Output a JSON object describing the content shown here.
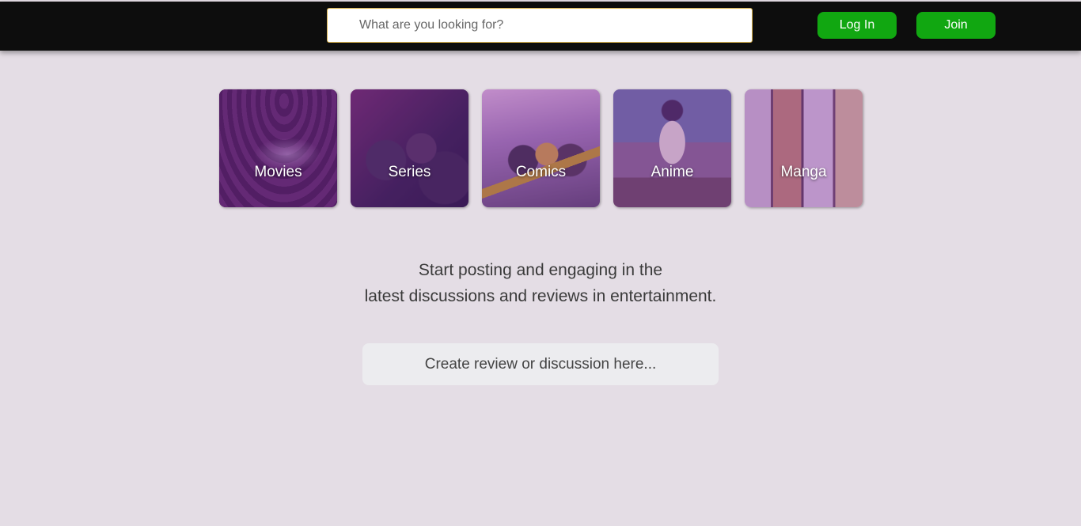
{
  "header": {
    "search": {
      "placeholder": "What are you looking for?",
      "value": ""
    },
    "login_label": "Log In",
    "join_label": "Join"
  },
  "categories": [
    {
      "label": "Movies"
    },
    {
      "label": "Series"
    },
    {
      "label": "Comics"
    },
    {
      "label": "Anime"
    },
    {
      "label": "Manga"
    }
  ],
  "main": {
    "tagline_line1": "Start posting and engaging in the",
    "tagline_line2": "latest discussions and reviews in entertainment.",
    "compose_prompt": "Create review or discussion here..."
  },
  "colors": {
    "header_bg": "#0d0d0d",
    "page_bg": "#e4dde5",
    "button_green": "#11a711",
    "search_border": "#d9b24c",
    "card_overlay": "#7828a0"
  }
}
